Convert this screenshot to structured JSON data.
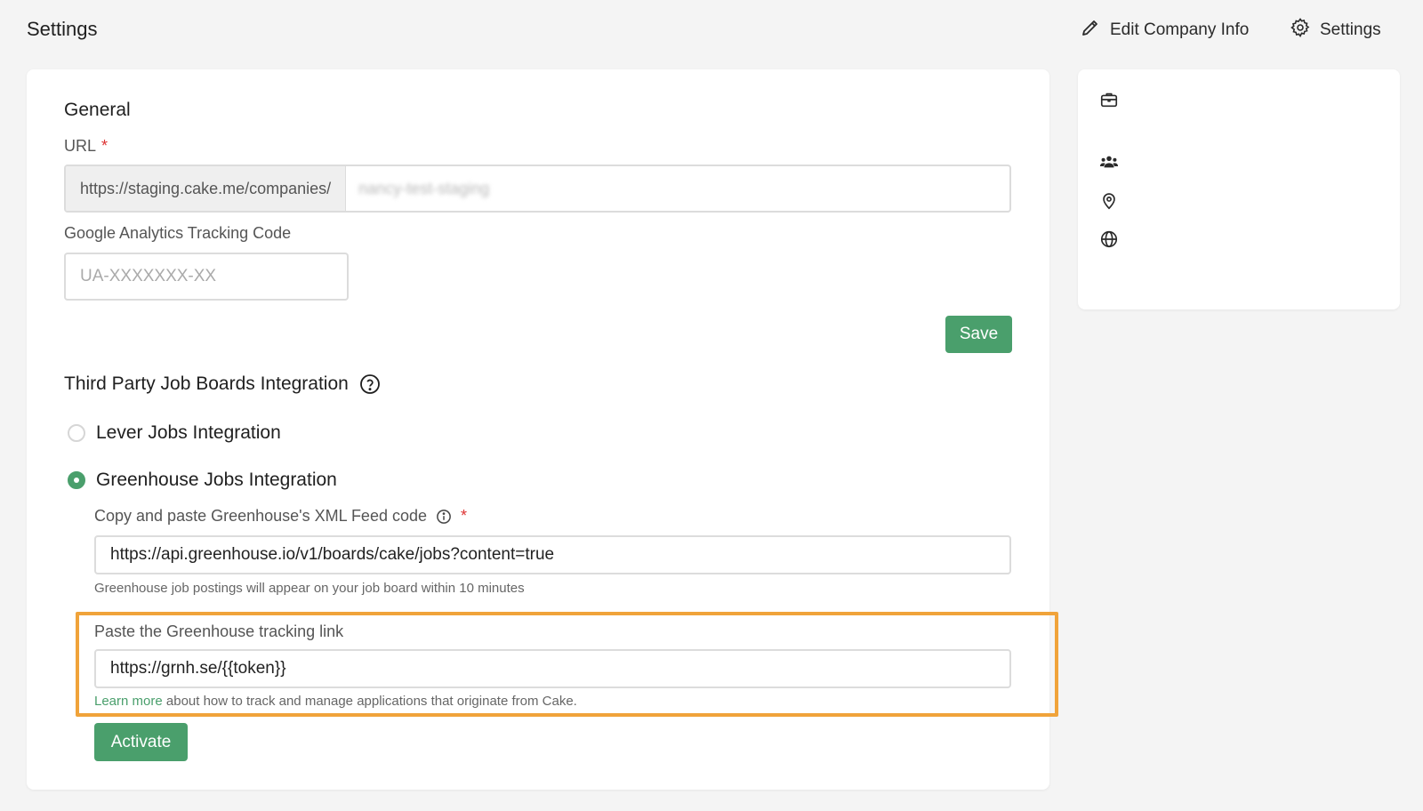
{
  "header": {
    "title": "Settings",
    "edit_company_label": "Edit Company Info",
    "settings_label": "Settings"
  },
  "general": {
    "title": "General",
    "url_label": "URL",
    "required_mark": "*",
    "url_prefix": "https://staging.cake.me/companies/",
    "url_slug": "nancy-test-staging",
    "ga_label": "Google Analytics Tracking Code",
    "ga_placeholder": "UA-XXXXXXX-XX",
    "save_label": "Save"
  },
  "integration": {
    "title": "Third Party Job Boards Integration",
    "lever_label": "Lever Jobs Integration",
    "greenhouse_label": "Greenhouse Jobs Integration",
    "selected": "greenhouse",
    "xml_label": "Copy and paste Greenhouse's XML Feed code",
    "xml_value": "https://api.greenhouse.io/v1/boards/cake/jobs?content=true",
    "xml_help": "Greenhouse job postings will appear on your job board within 10 minutes",
    "tracking_label": "Paste the Greenhouse tracking link",
    "tracking_value": "https://grnh.se/{{token}}",
    "learn_more": "Learn more",
    "learn_more_rest": " about how to track and manage applications that originate from Cake.",
    "activate_label": "Activate"
  },
  "sidebar": {
    "icons": [
      "briefcase-icon",
      "users-icon",
      "location-pin-icon",
      "globe-icon"
    ]
  },
  "colors": {
    "accent": "#4a9f6c",
    "highlight": "#f0a33a",
    "required": "#dd3333"
  }
}
